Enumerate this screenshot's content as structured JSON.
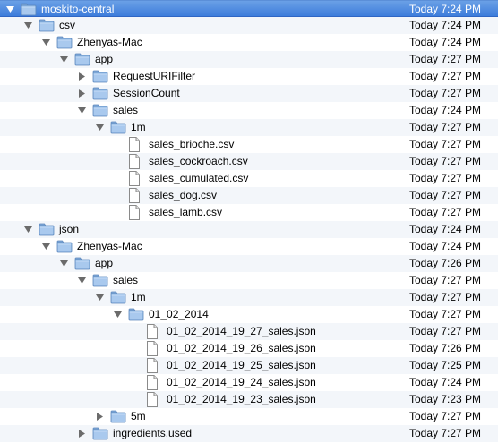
{
  "rows": [
    {
      "name": "moskito-central",
      "date": "Today 7:24 PM",
      "depth": 0,
      "kind": "folder",
      "expanded": true,
      "selected": true
    },
    {
      "name": "csv",
      "date": "Today 7:24 PM",
      "depth": 1,
      "kind": "folder",
      "expanded": true
    },
    {
      "name": "Zhenyas-Mac",
      "date": "Today 7:24 PM",
      "depth": 2,
      "kind": "folder",
      "expanded": true
    },
    {
      "name": "app",
      "date": "Today 7:27 PM",
      "depth": 3,
      "kind": "folder",
      "expanded": true
    },
    {
      "name": "RequestURIFilter",
      "date": "Today 7:27 PM",
      "depth": 4,
      "kind": "folder",
      "expanded": false
    },
    {
      "name": "SessionCount",
      "date": "Today 7:27 PM",
      "depth": 4,
      "kind": "folder",
      "expanded": false
    },
    {
      "name": "sales",
      "date": "Today 7:24 PM",
      "depth": 4,
      "kind": "folder",
      "expanded": true
    },
    {
      "name": "1m",
      "date": "Today 7:27 PM",
      "depth": 5,
      "kind": "folder",
      "expanded": true
    },
    {
      "name": "sales_brioche.csv",
      "date": "Today 7:27 PM",
      "depth": 6,
      "kind": "file"
    },
    {
      "name": "sales_cockroach.csv",
      "date": "Today 7:27 PM",
      "depth": 6,
      "kind": "file"
    },
    {
      "name": "sales_cumulated.csv",
      "date": "Today 7:27 PM",
      "depth": 6,
      "kind": "file"
    },
    {
      "name": "sales_dog.csv",
      "date": "Today 7:27 PM",
      "depth": 6,
      "kind": "file"
    },
    {
      "name": "sales_lamb.csv",
      "date": "Today 7:27 PM",
      "depth": 6,
      "kind": "file"
    },
    {
      "name": "json",
      "date": "Today 7:24 PM",
      "depth": 1,
      "kind": "folder",
      "expanded": true
    },
    {
      "name": "Zhenyas-Mac",
      "date": "Today 7:24 PM",
      "depth": 2,
      "kind": "folder",
      "expanded": true
    },
    {
      "name": "app",
      "date": "Today 7:26 PM",
      "depth": 3,
      "kind": "folder",
      "expanded": true
    },
    {
      "name": "sales",
      "date": "Today 7:27 PM",
      "depth": 4,
      "kind": "folder",
      "expanded": true
    },
    {
      "name": "1m",
      "date": "Today 7:27 PM",
      "depth": 5,
      "kind": "folder",
      "expanded": true
    },
    {
      "name": "01_02_2014",
      "date": "Today 7:27 PM",
      "depth": 6,
      "kind": "folder",
      "expanded": true
    },
    {
      "name": "01_02_2014_19_27_sales.json",
      "date": "Today 7:27 PM",
      "depth": 7,
      "kind": "file"
    },
    {
      "name": "01_02_2014_19_26_sales.json",
      "date": "Today 7:26 PM",
      "depth": 7,
      "kind": "file"
    },
    {
      "name": "01_02_2014_19_25_sales.json",
      "date": "Today 7:25 PM",
      "depth": 7,
      "kind": "file"
    },
    {
      "name": "01_02_2014_19_24_sales.json",
      "date": "Today 7:24 PM",
      "depth": 7,
      "kind": "file"
    },
    {
      "name": "01_02_2014_19_23_sales.json",
      "date": "Today 7:23 PM",
      "depth": 7,
      "kind": "file"
    },
    {
      "name": "5m",
      "date": "Today 7:27 PM",
      "depth": 5,
      "kind": "folder",
      "expanded": false
    },
    {
      "name": "ingredients.used",
      "date": "Today 7:27 PM",
      "depth": 4,
      "kind": "folder",
      "expanded": false
    }
  ],
  "colors": {
    "selection": "#3d7ddb",
    "stripe": "#f3f6fa",
    "folder": "#8fb8e6"
  },
  "icons": {
    "folder": "folder-icon",
    "file": "file-icon",
    "disclosure_open": "disclosure-open-icon",
    "disclosure_closed": "disclosure-closed-icon"
  }
}
